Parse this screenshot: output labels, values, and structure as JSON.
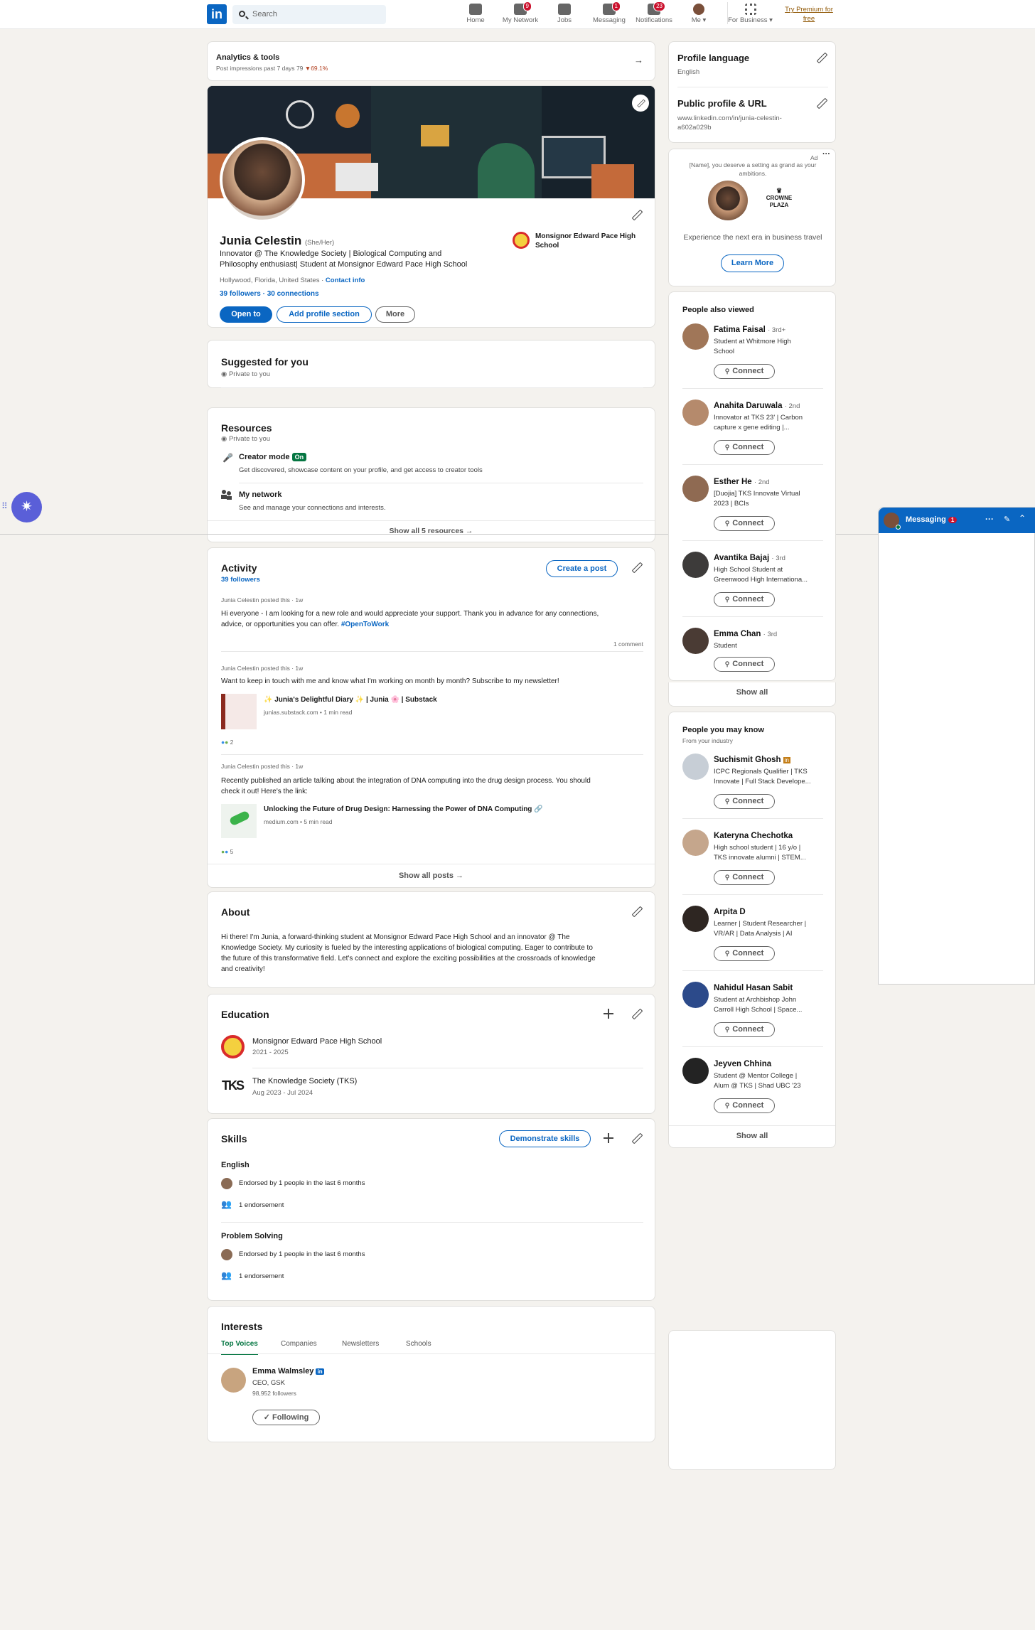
{
  "nav": {
    "search_placeholder": "Search",
    "items": [
      {
        "label": "Home"
      },
      {
        "label": "My Network",
        "badge": "9"
      },
      {
        "label": "Jobs"
      },
      {
        "label": "Messaging",
        "badge": "1"
      },
      {
        "label": "Notifications",
        "badge": "23"
      },
      {
        "label": "Me ▾"
      },
      {
        "label": "For Business ▾"
      }
    ],
    "premium_line1": "Try Premium for",
    "premium_line2": "free"
  },
  "analytics": {
    "title": "Analytics & tools",
    "sub_prefix": "Post impressions past 7 days",
    "impressions": "79",
    "change": "▼69.1%"
  },
  "profile": {
    "name": "Junia Celestin",
    "pronouns": "(She/Her)",
    "headline_1": "Innovator @ The Knowledge Society | Biological Computing and",
    "headline_2": "Philosophy enthusiast| Student at Monsignor Edward Pace High School",
    "location": "Hollywood, Florida, United States ·",
    "contact": "Contact info",
    "followers": "39 followers",
    "connections": "30 connections",
    "school_1": "Monsignor Edward Pace High",
    "school_2": "School",
    "btn_open": "Open to",
    "btn_add": "Add profile section",
    "btn_more": "More"
  },
  "suggested": {
    "title": "Suggested for you",
    "private": "Private to you"
  },
  "resources": {
    "title": "Resources",
    "private": "Private to you",
    "creator_title": "Creator mode",
    "creator_badge": "On",
    "creator_desc": "Get discovered, showcase content on your profile, and get access to creator tools",
    "network_title": "My network",
    "network_desc": "See and manage your connections and interests.",
    "show_all": "Show all 5 resources →"
  },
  "activity": {
    "title": "Activity",
    "followers": "39 followers",
    "create_post": "Create a post",
    "posts": [
      {
        "meta": "Junia Celestin posted this · 1w",
        "text_1": "Hi everyone - I am looking for a new role and would appreciate your support. Thank you in advance for any connections,",
        "text_2": "advice, or opportunities you can offer.",
        "hashtag": "#OpenToWork",
        "comments": "1 comment"
      },
      {
        "meta": "Junia Celestin posted this · 1w",
        "text_1": "Want to keep in touch with me and know what I'm working on month by month? Subscribe to my newsletter!",
        "link_title": "✨ Junia's Delightful Diary ✨ | Junia 🌸 | Substack",
        "link_sub": "junias.substack.com • 1 min read",
        "reactions": "2"
      },
      {
        "meta": "Junia Celestin posted this · 1w",
        "text_1": "Recently published an article talking about the integration of DNA computing into the drug design process. You should",
        "text_2": "check it out! Here's the link:",
        "link_title": "Unlocking the Future of Drug Design: Harnessing the Power of DNA Computing 🔗",
        "link_sub": "medium.com • 5 min read",
        "reactions": "5"
      }
    ],
    "show_all": "Show all posts →"
  },
  "about": {
    "title": "About",
    "lines": [
      "Hi there! I'm Junia, a forward-thinking student at Monsignor Edward Pace High School and an innovator @ The",
      "Knowledge Society. My curiosity is fueled by the interesting applications of biological computing. Eager to contribute to",
      "the future of this transformative field. Let's connect and explore the exciting possibilities at the crossroads of knowledge",
      "and creativity!"
    ]
  },
  "education": {
    "title": "Education",
    "items": [
      {
        "school": "Monsignor Edward Pace High School",
        "dates": "2021 - 2025"
      },
      {
        "school": "The Knowledge Society (TKS)",
        "dates": "Aug 2023 - Jul 2024"
      }
    ]
  },
  "skills": {
    "title": "Skills",
    "demonstrate": "Demonstrate skills",
    "items": [
      {
        "name": "English",
        "endorsed": "Endorsed by 1 people in the last 6 months",
        "count": "1 endorsement"
      },
      {
        "name": "Problem Solving",
        "endorsed": "Endorsed by 1 people in the last 6 months",
        "count": "1 endorsement"
      }
    ]
  },
  "interests": {
    "title": "Interests",
    "tabs": [
      "Top Voices",
      "Companies",
      "Newsletters",
      "Schools"
    ],
    "person": {
      "name": "Emma Walmsley",
      "role": "CEO, GSK",
      "followers": "98,952 followers",
      "button": "✓ Following"
    }
  },
  "sidebar": {
    "lang_title": "Profile language",
    "lang_value": "English",
    "url_title": "Public profile & URL",
    "url_1": "www.linkedin.com/in/junia-celestin-",
    "url_2": "a602a029b",
    "ad_label": "Ad",
    "ad_text_1": "[Name], you deserve a setting as grand as your",
    "ad_text_2": "ambitions.",
    "ad_brand_1": "CROWNE",
    "ad_brand_2": "PLAZA",
    "ad_desc": "Experience the next era in business travel",
    "ad_button": "Learn More"
  },
  "also_viewed": {
    "title": "People also viewed",
    "people": [
      {
        "name": "Fatima Faisal",
        "degree": "· 3rd+",
        "sub_1": "Student at Whitmore High",
        "sub_2": "School"
      },
      {
        "name": "Anahita Daruwala",
        "degree": "· 2nd",
        "sub_1": "Innovator at TKS 23' | Carbon",
        "sub_2": "capture x gene editing |..."
      },
      {
        "name": "Esther He",
        "degree": "· 2nd",
        "sub_1": "[Duojia] TKS Innovate Virtual",
        "sub_2": "2023 | BCIs"
      },
      {
        "name": "Avantika Bajaj",
        "degree": "· 3rd",
        "sub_1": "High School Student at",
        "sub_2": "Greenwood High Internationa..."
      },
      {
        "name": "Emma Chan",
        "degree": "· 3rd",
        "sub_1": "Student",
        "sub_2": ""
      }
    ],
    "connect": "Connect",
    "show_all": "Show all"
  },
  "may_know": {
    "title": "People you may know",
    "sub": "From your industry",
    "people": [
      {
        "name": "Suchismit Ghosh",
        "sub_1": "ICPC Regionals Qualifier | TKS",
        "sub_2": "Innovate | Full Stack Develope..."
      },
      {
        "name": "Kateryna Chechotka",
        "sub_1": "High school student | 16 y/o |",
        "sub_2": "TKS innovate alumni | STEM..."
      },
      {
        "name": "Arpita D",
        "sub_1": "Learner | Student Researcher |",
        "sub_2": "VR/AR | Data Analysis | AI"
      },
      {
        "name": "Nahidul Hasan Sabit",
        "sub_1": "Student at Archbishop John",
        "sub_2": "Carroll High School | Space..."
      },
      {
        "name": "Jeyven Chhina",
        "sub_1": "Student @ Mentor College |",
        "sub_2": "Alum @ TKS | Shad UBC '23"
      }
    ],
    "connect": "Connect",
    "show_all": "Show all"
  },
  "messaging": {
    "label": "Messaging",
    "badge": "1"
  },
  "colors": {
    "brand": "#0a66c2",
    "premium": "#915907",
    "badge": "#cb112d",
    "creator_on": "#057642"
  }
}
